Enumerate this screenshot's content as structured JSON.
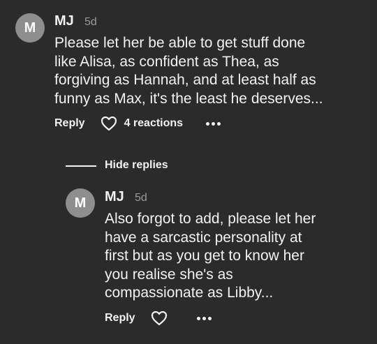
{
  "comment": {
    "avatar_letter": "M",
    "author": "MJ",
    "time": "5d",
    "lines": [
      "Please let her be able to get stuff done",
      "like Alisa, as confident as Thea, as",
      "forgiving as Hannah, and at least half as",
      "funny as Max, it's the least he deserves..."
    ],
    "reply_label": "Reply",
    "reactions_label": "4 reactions",
    "like_icon": "heart-outline",
    "more_icon": "ellipsis"
  },
  "replies_toggle": {
    "label": "Hide replies"
  },
  "reply": {
    "avatar_letter": "M",
    "author": "MJ",
    "time": "5d",
    "lines": [
      "Also forgot to add, please let her",
      "have a sarcastic personality at",
      "first but as you get to know her",
      "you realise she's as",
      "compassionate as Libby..."
    ],
    "reply_label": "Reply",
    "like_icon": "heart-outline",
    "more_icon": "ellipsis"
  },
  "colors": {
    "background": "#2b2b2b",
    "avatar": "#8e8e8e",
    "text": "#f2f2f2",
    "muted": "#9a9a9a"
  }
}
